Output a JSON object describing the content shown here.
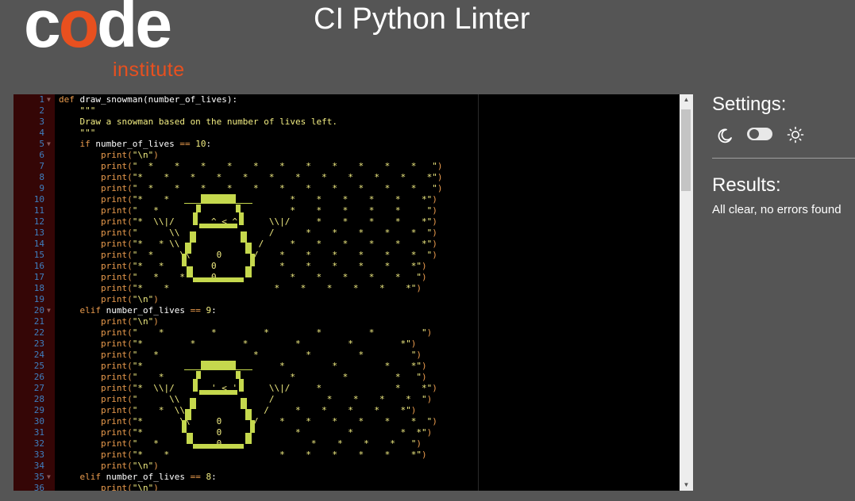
{
  "brand": {
    "logo_part1": "c",
    "logo_o": "o",
    "logo_part2": "de",
    "logo_sub": "institute"
  },
  "header": {
    "title": "CI Python Linter"
  },
  "editor": {
    "lines": [
      {
        "n": "1",
        "fold": true,
        "segments": [
          {
            "c": "kw",
            "t": "def "
          },
          {
            "c": "fn",
            "t": "draw_snowman(number_of_lives):"
          }
        ]
      },
      {
        "n": "2",
        "segments": [
          {
            "c": "str",
            "t": "    \"\"\""
          }
        ]
      },
      {
        "n": "3",
        "segments": [
          {
            "c": "str",
            "t": "    Draw a snowman based on the number of lives left."
          }
        ]
      },
      {
        "n": "4",
        "segments": [
          {
            "c": "str",
            "t": "    \"\"\""
          }
        ]
      },
      {
        "n": "5",
        "fold": true,
        "segments": [
          {
            "c": "kw",
            "t": "    if "
          },
          {
            "c": "fn",
            "t": "number_of_lives "
          },
          {
            "c": "kw",
            "t": "== "
          },
          {
            "c": "num",
            "t": "10"
          },
          {
            "c": "fn",
            "t": ":"
          }
        ]
      },
      {
        "n": "6",
        "segments": [
          {
            "c": "kw",
            "t": "        print("
          },
          {
            "c": "str",
            "t": "\"\\n\""
          },
          {
            "c": "kw",
            "t": ")"
          }
        ]
      },
      {
        "n": "7",
        "segments": [
          {
            "c": "kw",
            "t": "        print("
          },
          {
            "c": "str",
            "t": "\"  *    *    *    *    *    *    *    *    *    *    *   \""
          },
          {
            "c": "kw",
            "t": ")"
          }
        ]
      },
      {
        "n": "8",
        "segments": [
          {
            "c": "kw",
            "t": "        print("
          },
          {
            "c": "str",
            "t": "\"*    *    *    *    *    *    *    *    *    *    *    *\""
          },
          {
            "c": "kw",
            "t": ")"
          }
        ]
      },
      {
        "n": "9",
        "segments": [
          {
            "c": "kw",
            "t": "        print("
          },
          {
            "c": "str",
            "t": "\"  *    *    *    *    *    *    *    *    *    *    *   \""
          },
          {
            "c": "kw",
            "t": ")"
          }
        ]
      },
      {
        "n": "10",
        "segments": [
          {
            "c": "kw",
            "t": "        print("
          },
          {
            "c": "str",
            "t": "\"*    *                       *    *    *    *    *    *\""
          },
          {
            "c": "kw",
            "t": ")"
          }
        ]
      },
      {
        "n": "11",
        "segments": [
          {
            "c": "kw",
            "t": "        print("
          },
          {
            "c": "str",
            "t": "\"   *                         *    *    *    *    *     \""
          },
          {
            "c": "kw",
            "t": ")"
          }
        ]
      },
      {
        "n": "12",
        "segments": [
          {
            "c": "kw",
            "t": "        print("
          },
          {
            "c": "str",
            "t": "\"*  \\\\|/       ^ < ^      \\\\|/     *    *    *    *    *\""
          },
          {
            "c": "kw",
            "t": ")"
          }
        ]
      },
      {
        "n": "13",
        "segments": [
          {
            "c": "kw",
            "t": "        print("
          },
          {
            "c": "str",
            "t": "\"      \\\\                 /      *    *    *    *    *  \""
          },
          {
            "c": "kw",
            "t": ")"
          }
        ]
      },
      {
        "n": "14",
        "segments": [
          {
            "c": "kw",
            "t": "        print("
          },
          {
            "c": "str",
            "t": "\"*   * \\\\               /     *    *    *    *    *    *\""
          },
          {
            "c": "kw",
            "t": ")"
          }
        ]
      },
      {
        "n": "15",
        "segments": [
          {
            "c": "kw",
            "t": "        print("
          },
          {
            "c": "str",
            "t": "\"  *     \\\\     0      /    *    *    *    *    *    *  \""
          },
          {
            "c": "kw",
            "t": ")"
          }
        ]
      },
      {
        "n": "16",
        "segments": [
          {
            "c": "kw",
            "t": "        print("
          },
          {
            "c": "str",
            "t": "\"*   *         0            *    *    *    *    *    *\""
          },
          {
            "c": "kw",
            "t": ")"
          }
        ]
      },
      {
        "n": "17",
        "segments": [
          {
            "c": "kw",
            "t": "        print("
          },
          {
            "c": "str",
            "t": "\"   *    *     0              *    *    *    *    *   \""
          },
          {
            "c": "kw",
            "t": ")"
          }
        ]
      },
      {
        "n": "18",
        "segments": [
          {
            "c": "kw",
            "t": "        print("
          },
          {
            "c": "str",
            "t": "\"*    *                    *    *    *    *    *    *\""
          },
          {
            "c": "kw",
            "t": ")"
          }
        ]
      },
      {
        "n": "19",
        "segments": [
          {
            "c": "kw",
            "t": "        print("
          },
          {
            "c": "str",
            "t": "\"\\n\""
          },
          {
            "c": "kw",
            "t": ")"
          }
        ]
      },
      {
        "n": "20",
        "fold": true,
        "segments": [
          {
            "c": "kw",
            "t": "    elif "
          },
          {
            "c": "fn",
            "t": "number_of_lives "
          },
          {
            "c": "kw",
            "t": "== "
          },
          {
            "c": "num",
            "t": "9"
          },
          {
            "c": "fn",
            "t": ":"
          }
        ]
      },
      {
        "n": "21",
        "segments": [
          {
            "c": "kw",
            "t": "        print("
          },
          {
            "c": "str",
            "t": "\"\\n\""
          },
          {
            "c": "kw",
            "t": ")"
          }
        ]
      },
      {
        "n": "22",
        "segments": [
          {
            "c": "kw",
            "t": "        print("
          },
          {
            "c": "str",
            "t": "\"    *         *         *         *         *         \""
          },
          {
            "c": "kw",
            "t": ")"
          }
        ]
      },
      {
        "n": "23",
        "segments": [
          {
            "c": "kw",
            "t": "        print("
          },
          {
            "c": "str",
            "t": "\"*         *         *         *         *         *\""
          },
          {
            "c": "kw",
            "t": ")"
          }
        ]
      },
      {
        "n": "24",
        "segments": [
          {
            "c": "kw",
            "t": "        print("
          },
          {
            "c": "str",
            "t": "\"   *                  *         *         *         \""
          },
          {
            "c": "kw",
            "t": ")"
          }
        ]
      },
      {
        "n": "25",
        "segments": [
          {
            "c": "kw",
            "t": "        print("
          },
          {
            "c": "str",
            "t": "\"*                          *         *         *    *\""
          },
          {
            "c": "kw",
            "t": ")"
          }
        ]
      },
      {
        "n": "26",
        "segments": [
          {
            "c": "kw",
            "t": "        print("
          },
          {
            "c": "str",
            "t": "\"    *                        *         *         *   \""
          },
          {
            "c": "kw",
            "t": ")"
          }
        ]
      },
      {
        "n": "27",
        "segments": [
          {
            "c": "kw",
            "t": "        print("
          },
          {
            "c": "str",
            "t": "\"*  \\\\|/       ' < '      \\\\|/     *              *    *\""
          },
          {
            "c": "kw",
            "t": ")"
          }
        ]
      },
      {
        "n": "28",
        "segments": [
          {
            "c": "kw",
            "t": "        print("
          },
          {
            "c": "str",
            "t": "\"      \\\\                 /          *    *    *    *  \""
          },
          {
            "c": "kw",
            "t": ")"
          }
        ]
      },
      {
        "n": "29",
        "segments": [
          {
            "c": "kw",
            "t": "        print("
          },
          {
            "c": "str",
            "t": "\"    *  \\\\               /     *    *    *    *    *\""
          },
          {
            "c": "kw",
            "t": ")"
          }
        ]
      },
      {
        "n": "30",
        "segments": [
          {
            "c": "kw",
            "t": "        print("
          },
          {
            "c": "str",
            "t": "\"*       \\\\     0      /    *    *    *    *    *    *  \""
          },
          {
            "c": "kw",
            "t": ")"
          }
        ]
      },
      {
        "n": "31",
        "segments": [
          {
            "c": "kw",
            "t": "        print("
          },
          {
            "c": "str",
            "t": "\"*              0              *         *         *  *\""
          },
          {
            "c": "kw",
            "t": ")"
          }
        ]
      },
      {
        "n": "32",
        "segments": [
          {
            "c": "kw",
            "t": "        print("
          },
          {
            "c": "str",
            "t": "\"   *           0                 *    *    *    *   \""
          },
          {
            "c": "kw",
            "t": ")"
          }
        ]
      },
      {
        "n": "33",
        "segments": [
          {
            "c": "kw",
            "t": "        print("
          },
          {
            "c": "str",
            "t": "\"*    *                     *    *    *    *    *    *\""
          },
          {
            "c": "kw",
            "t": ")"
          }
        ]
      },
      {
        "n": "34",
        "segments": [
          {
            "c": "kw",
            "t": "        print("
          },
          {
            "c": "str",
            "t": "\"\\n\""
          },
          {
            "c": "kw",
            "t": ")"
          }
        ]
      },
      {
        "n": "35",
        "fold": true,
        "segments": [
          {
            "c": "kw",
            "t": "    elif "
          },
          {
            "c": "fn",
            "t": "number_of_lives "
          },
          {
            "c": "kw",
            "t": "== "
          },
          {
            "c": "num",
            "t": "8"
          },
          {
            "c": "fn",
            "t": ":"
          }
        ]
      },
      {
        "n": "36",
        "segments": [
          {
            "c": "kw",
            "t": "        print("
          },
          {
            "c": "str",
            "t": "\"\\n\""
          },
          {
            "c": "kw",
            "t": ")"
          }
        ]
      }
    ]
  },
  "settings": {
    "title": "Settings:",
    "dark_mode_icon": "moon-icon",
    "light_mode_icon": "sun-icon"
  },
  "results": {
    "title": "Results:",
    "message": "All clear, no errors found"
  },
  "colors": {
    "background": "#555555",
    "brand_orange": "#e8501f",
    "editor_bg": "#000000",
    "gutter_bg": "#350606",
    "snow": "#c5d84d"
  }
}
